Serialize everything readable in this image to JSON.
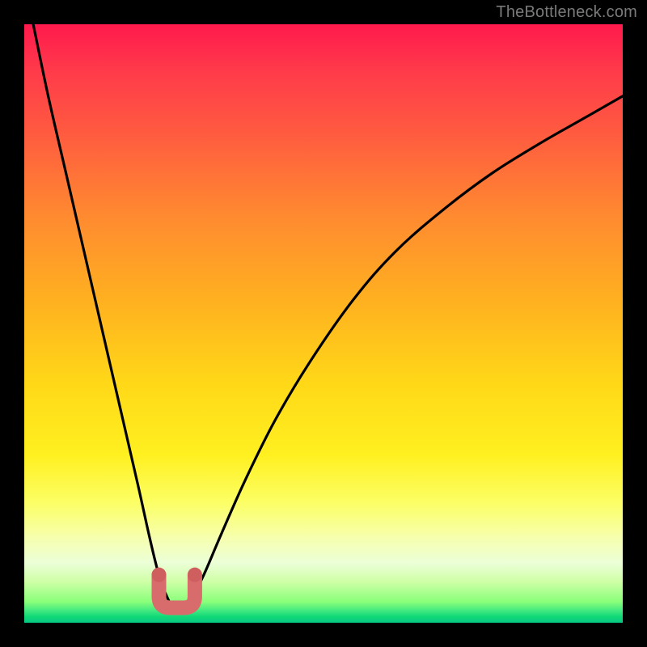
{
  "watermark": "TheBottleneck.com",
  "colors": {
    "background": "#000000",
    "curve": "#000000",
    "marker": "#d86b6b",
    "marker_dot": "#cf5f5f"
  },
  "chart_data": {
    "type": "line",
    "title": "",
    "xlabel": "",
    "ylabel": "",
    "xlim": [
      0,
      100
    ],
    "ylim": [
      0,
      100
    ],
    "grid": false,
    "series": [
      {
        "name": "bottleneck-curve",
        "x": [
          1.5,
          4,
          7,
          10,
          13,
          16,
          19,
          21,
          22.5,
          24,
          25,
          26,
          27,
          28,
          30,
          33,
          37,
          42,
          48,
          55,
          62,
          70,
          78,
          86,
          93,
          100
        ],
        "y": [
          100,
          88,
          75,
          62,
          49,
          36,
          23,
          14,
          8,
          4,
          2.5,
          2.5,
          2.5,
          4,
          8,
          15,
          24,
          34,
          44,
          54,
          62,
          69,
          75,
          80,
          84,
          88
        ]
      }
    ],
    "marker": {
      "name": "optimal-zone",
      "x_range": [
        22.5,
        28.5
      ],
      "y": 2.5,
      "endpoints": [
        {
          "x": 22.5,
          "y": 8
        },
        {
          "x": 28.5,
          "y": 8
        }
      ]
    }
  }
}
